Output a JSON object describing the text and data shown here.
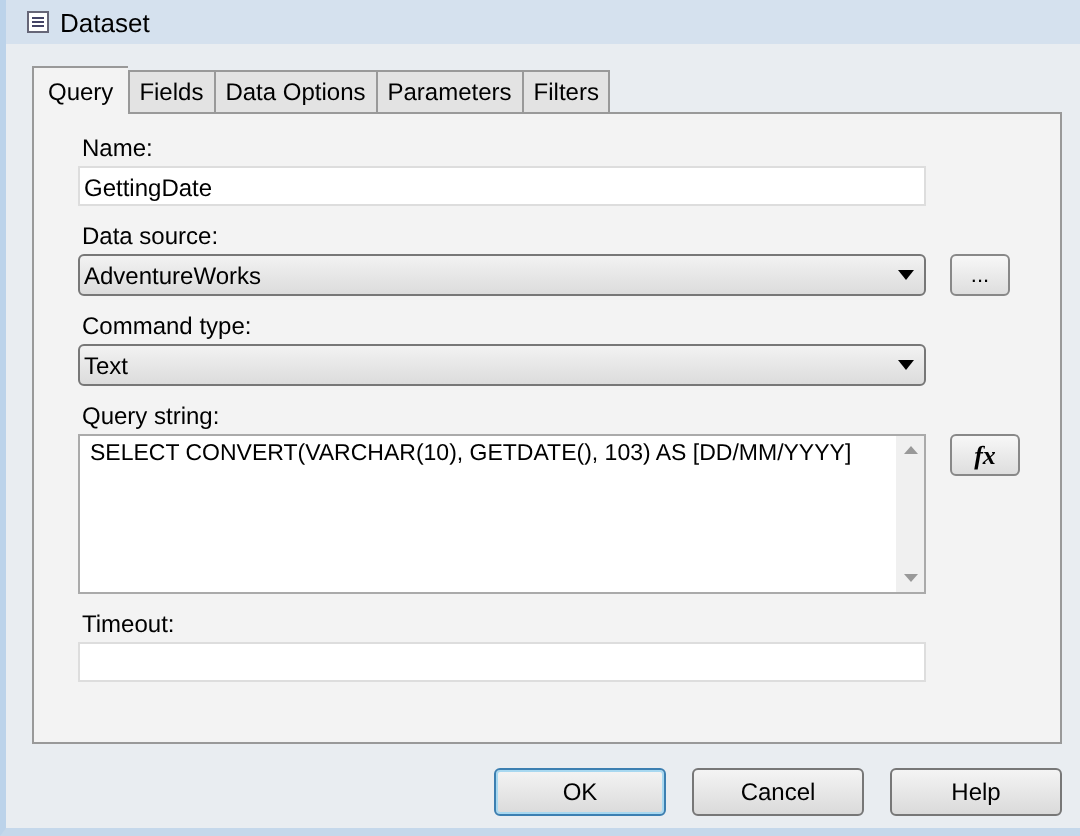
{
  "window": {
    "title": "Dataset"
  },
  "tabs": [
    {
      "label": "Query",
      "selected": true
    },
    {
      "label": "Fields",
      "selected": false
    },
    {
      "label": "Data Options",
      "selected": false
    },
    {
      "label": "Parameters",
      "selected": false
    },
    {
      "label": "Filters",
      "selected": false
    }
  ],
  "form": {
    "name": {
      "label": "Name:",
      "value": "GettingDate"
    },
    "data_source": {
      "label": "Data source:",
      "value": "AdventureWorks",
      "browse_button": "..."
    },
    "command_type": {
      "label": "Command type:",
      "value": "Text"
    },
    "query_string": {
      "label": "Query string:",
      "value": "SELECT CONVERT(VARCHAR(10), GETDATE(), 103) AS [DD/MM/YYYY]",
      "expression_button": "fx"
    },
    "timeout": {
      "label": "Timeout:"
    }
  },
  "buttons": [
    {
      "label": "OK",
      "default": true
    },
    {
      "label": "Cancel",
      "default": false
    },
    {
      "label": "Help",
      "default": false
    }
  ]
}
